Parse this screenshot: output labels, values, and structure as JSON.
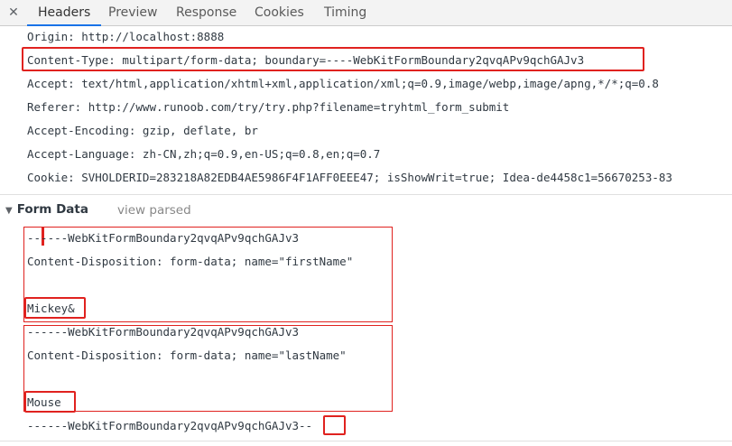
{
  "tabs": {
    "close_icon": "close-icon",
    "items": [
      "Headers",
      "Preview",
      "Response",
      "Cookies",
      "Timing"
    ],
    "active": "Headers"
  },
  "request_headers": [
    "Origin: http://localhost:8888",
    "Content-Type: multipart/form-data; boundary=----WebKitFormBoundary2qvqAPv9qchGAJv3",
    "Accept: text/html,application/xhtml+xml,application/xml;q=0.9,image/webp,image/apng,*/*;q=0.8",
    "Referer: http://www.runoob.com/try/try.php?filename=tryhtml_form_submit",
    "Accept-Encoding: gzip, deflate, br",
    "Accept-Language: zh-CN,zh;q=0.9,en-US;q=0.8,en;q=0.7",
    "Cookie: SVHOLDERID=283218A82EDB4AE5986F4F1AFF0EEE47; isShowWrit=true; Idea-de4458c1=56670253-83"
  ],
  "form_data": {
    "title": "Form Data",
    "view_parsed": "view parsed",
    "lines": [
      "------WebKitFormBoundary2qvqAPv9qchGAJv3",
      "Content-Disposition: form-data; name=\"firstName\"",
      "",
      "Mickey&",
      "------WebKitFormBoundary2qvqAPv9qchGAJv3",
      "Content-Disposition: form-data; name=\"lastName\"",
      "",
      "Mouse",
      "------WebKitFormBoundary2qvqAPv9qchGAJv3--"
    ]
  },
  "colors": {
    "highlight": "#e0221f",
    "tab_active": "#1a73e8"
  }
}
